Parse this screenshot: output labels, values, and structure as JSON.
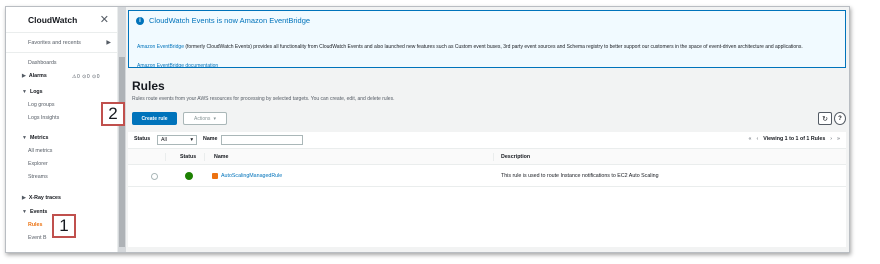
{
  "sidebar": {
    "title": "CloudWatch",
    "close_glyph": "✕",
    "favorites": "Favorites and recents",
    "favorites_arrow": "▶",
    "dashboards": "Dashboards",
    "alarms": "Alarms",
    "alarm_counts": "⚠0 ⊙0 ⊙0",
    "logs": "Logs",
    "log_groups": "Log groups",
    "logs_insights": "Logs Insights",
    "metrics": "Metrics",
    "all_metrics": "All metrics",
    "explorer": "Explorer",
    "streams": "Streams",
    "xray": "X-Ray traces",
    "events": "Events",
    "rules": "Rules",
    "event_buses": "Event B"
  },
  "flash": {
    "title": "CloudWatch Events is now Amazon EventBridge",
    "body_link": "Amazon EventBridge",
    "body_text": " (formerly CloudWatch Events) provides all functionality from CloudWatch Events and also launched new features such as Custom event buses, 3rd party event sources and Schema registry to better support our customers in the space of event-driven architecture and applications.",
    "doc_link": "Amazon EventBridge documentation"
  },
  "page": {
    "title": "Rules",
    "description": "Rules route events from your AWS resources for processing by selected targets. You can create, edit, and delete rules."
  },
  "toolbar": {
    "create_label": "Create rule",
    "actions_label": "Actions",
    "actions_caret": "▾",
    "refresh_glyph": "↻",
    "help_glyph": "?"
  },
  "filter": {
    "status_label": "Status",
    "status_value": "All",
    "status_caret": "▾",
    "name_label": "Name",
    "name_value": "",
    "pager_first": "«",
    "pager_prev": "‹",
    "pager_text": "Viewing 1 to 1 of 1 Rules",
    "pager_next": "›",
    "pager_last": "»"
  },
  "table": {
    "columns": [
      "Status",
      "Name",
      "Description"
    ],
    "rows": [
      {
        "status": "enabled",
        "name": "AutoScalingManagedRule",
        "description": "This rule is used to route Instance notifications to EC2 Auto Scaling"
      }
    ]
  },
  "annotations": [
    "1",
    "2"
  ],
  "colors": {
    "accent": "#0073bb",
    "active_nav": "#ec7211",
    "status_enabled": "#1d8102",
    "annotation_border": "#c0504d"
  }
}
